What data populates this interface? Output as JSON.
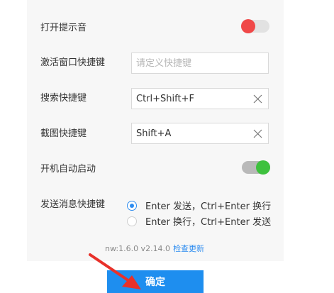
{
  "settings": {
    "sound_label": "打开提示音",
    "sound_enabled": false,
    "activate_label": "激活窗口快捷键",
    "activate_value": "",
    "activate_placeholder": "请定义快捷键",
    "search_label": "搜索快捷键",
    "search_value": "Ctrl+Shift+F",
    "screenshot_label": "截图快捷键",
    "screenshot_value": "Shift+A",
    "autostart_label": "开机自动启动",
    "autostart_enabled": true,
    "send_label": "发送消息快捷键",
    "send_options": [
      {
        "label": "Enter 发送，Ctrl+Enter 换行",
        "selected": true
      },
      {
        "label": "Enter 换行，Ctrl+Enter 发送",
        "selected": false
      }
    ]
  },
  "footer": {
    "version_text": "nw:1.6.0 v2.14.0",
    "check_update_label": "检查更新",
    "confirm_label": "确定"
  },
  "colors": {
    "accent": "#1e8eef",
    "toggle_off_knob": "#f04848",
    "toggle_on_knob": "#3ec13e",
    "annotation_arrow": "#e8312a"
  },
  "icons": {
    "clear": "close-icon",
    "annotation": "red-arrow-icon"
  }
}
